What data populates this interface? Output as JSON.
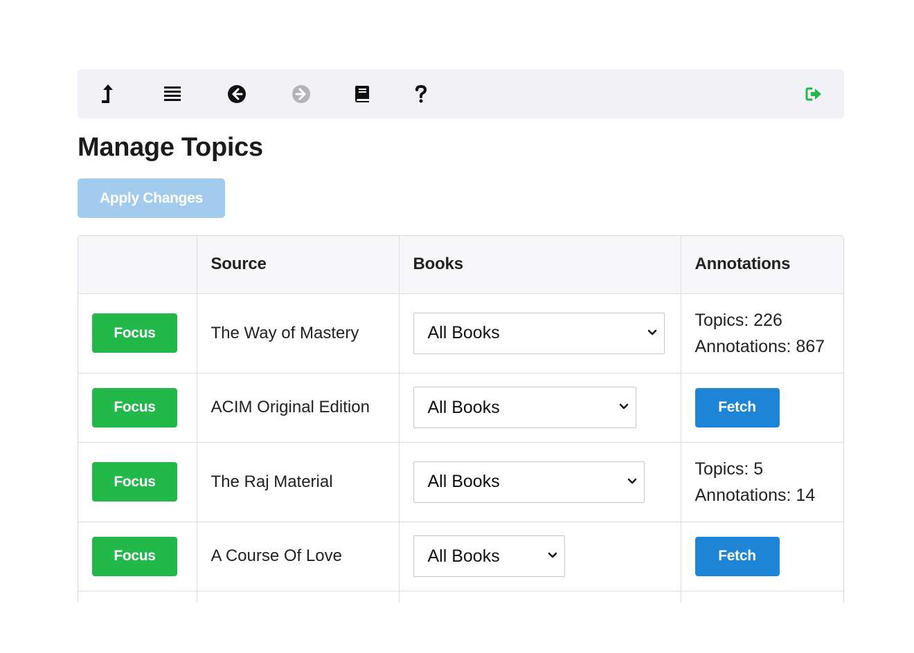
{
  "toolbar": {
    "icons": [
      "up-arrow-icon",
      "list-icon",
      "back-arrow-icon",
      "forward-arrow-icon",
      "book-icon",
      "help-icon",
      "sign-out-icon"
    ],
    "accent_color": "#22b84a"
  },
  "page": {
    "title": "Manage Topics",
    "apply_label": "Apply Changes"
  },
  "table": {
    "headers": [
      "",
      "Source",
      "Books",
      "Annotations"
    ],
    "rows": [
      {
        "focus_label": "Focus",
        "source": "The Way of Mastery",
        "books_selected": "All Books",
        "topics": "Topics: 226",
        "annotations": "Annotations: 867"
      },
      {
        "focus_label": "Focus",
        "source": "ACIM Original Edition",
        "books_selected": "All Books",
        "fetch_label": "Fetch"
      },
      {
        "focus_label": "Focus",
        "source": "The Raj Material",
        "books_selected": "All Books",
        "topics": "Topics: 5",
        "annotations": "Annotations: 14"
      },
      {
        "focus_label": "Focus",
        "source": "A Course Of Love",
        "books_selected": "All Books",
        "fetch_label": "Fetch"
      }
    ]
  },
  "colors": {
    "focus": "#22b84a",
    "fetch": "#1d84d6",
    "apply_disabled": "#a3cbee"
  }
}
